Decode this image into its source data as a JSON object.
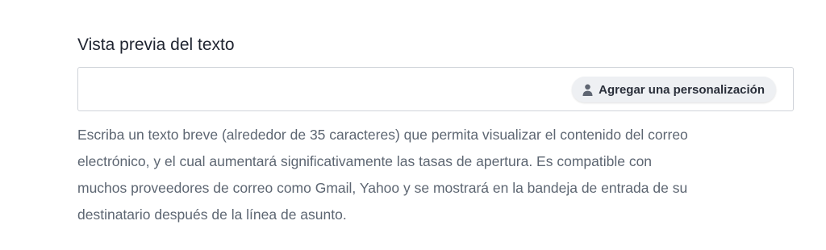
{
  "field": {
    "label": "Vista previa del texto",
    "value": "",
    "placeholder": ""
  },
  "personalize_button": {
    "label": "Agregar una personalización",
    "icon": "person-icon"
  },
  "helper": {
    "lines": [
      "Escriba un texto breve (alrededor de 35 caracteres) que permita visualizar el contenido del correo",
      "electrónico, y el cual aumentará significativamente las tasas de apertura. Es compatible con",
      "muchos proveedores de correo como Gmail, Yahoo y se mostrará en la bandeja de entrada de su",
      "destinatario después de la línea de asunto."
    ]
  },
  "colors": {
    "label_text": "#1f2430",
    "helper_text": "#5d6672",
    "button_bg": "#eef0f3",
    "border": "#cfd3d9"
  }
}
